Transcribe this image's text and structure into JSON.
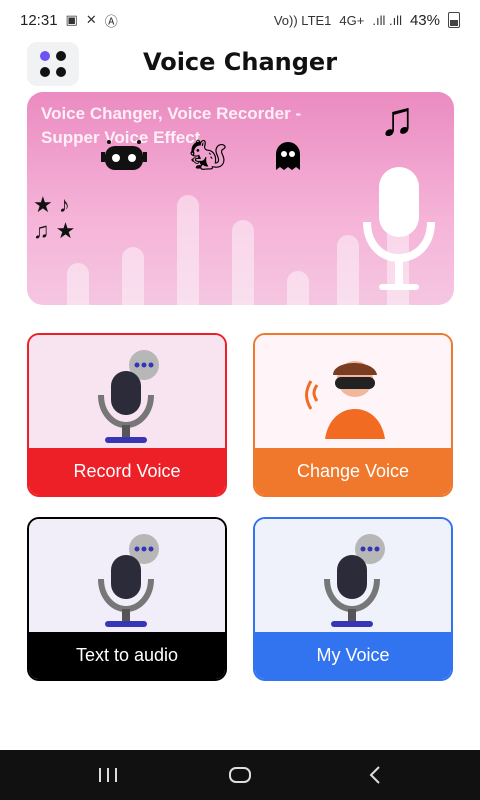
{
  "status_bar": {
    "time": "12:31",
    "network_label": "Vo)) LTE1",
    "signal_label": "4G+",
    "battery": "43%"
  },
  "header": {
    "title": "Voice Changer"
  },
  "banner": {
    "text": "Voice Changer, Voice Recorder - Supper Voice Effect",
    "accent": "#eb8bc1"
  },
  "cards": [
    {
      "label": "Record Voice",
      "color": "#ee2027",
      "top_bg": "#f8e4f1"
    },
    {
      "label": "Change Voice",
      "color": "#f0782d",
      "top_bg": "#fff4f8"
    },
    {
      "label": "Text to audio",
      "color": "#000000",
      "top_bg": "#f2eef9"
    },
    {
      "label": "My Voice",
      "color": "#3273f0",
      "top_bg": "#f0f2fb"
    }
  ],
  "icons": {
    "menu": "grid-menu-icon",
    "robot": "robot-icon",
    "squirrel": "squirrel-icon",
    "ghost": "ghost-icon",
    "music": "music-notes-icon",
    "mic": "microphone-icon",
    "person": "vr-headset-person-icon"
  }
}
